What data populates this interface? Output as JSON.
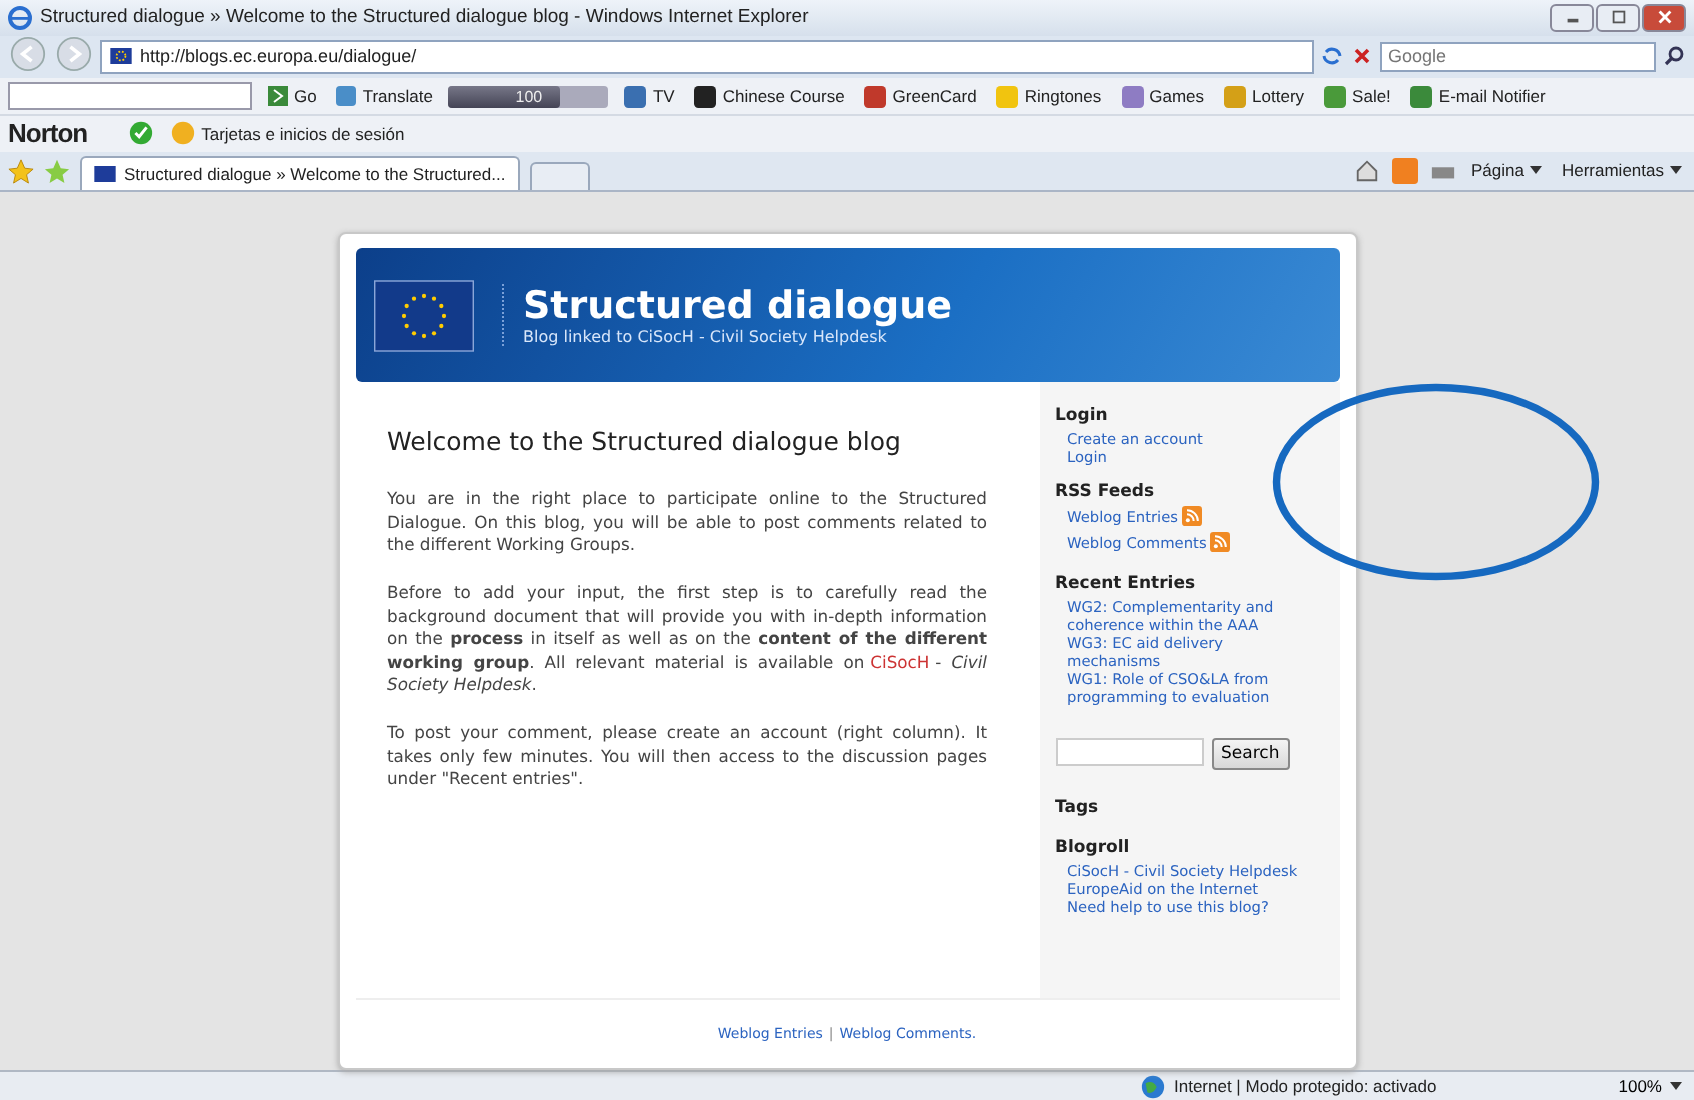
{
  "window": {
    "title": "Structured dialogue » Welcome to the Structured dialogue blog - Windows Internet Explorer"
  },
  "address_bar": {
    "url": "http://blogs.ec.europa.eu/dialogue/"
  },
  "search_box": {
    "placeholder": "Google"
  },
  "toolbar": {
    "go": "Go",
    "translate": "Translate",
    "volume": {
      "reading": "100",
      "level": 0.7
    },
    "items": [
      "TV",
      "Chinese Course",
      "GreenCard",
      "Ringtones",
      "Games",
      "Lottery",
      "Sale!",
      "E-mail Notifier"
    ]
  },
  "norton_bar": {
    "brand": "Norton",
    "cards": "Tarjetas e inicios de sesión"
  },
  "tabs": [
    {
      "label": "Structured dialogue » Welcome to the Structured...",
      "selected": true
    }
  ],
  "command_bar": [
    "Página",
    "Herramientas"
  ],
  "page": {
    "title": "Structured dialogue",
    "subtitle": "Blog linked to CiSocH - Civil Society Helpdesk",
    "heading": "Welcome to the Structured dialogue blog",
    "paragraphs": [
      {
        "before": "You are in the right place to participate online to the Structured Dialogue. On this blog, you will be able to post comments related to the different Working Groups."
      },
      {
        "before": "Before to add your input, the first step is to carefully read the background document that will provide you with in-depth information on the **process** in itself as well as on the **content of the different working group**. All relevant material is available on",
        "link": "CiSocH",
        "after": "- *Civil Society Helpdesk*."
      },
      {
        "before": "To post your comment, please create an account (right column). It takes only few minutes. You will then access to the discussion pages under \"Recent entries\"."
      }
    ],
    "sidebar": [
      {
        "kind": "heading",
        "text": "Login"
      },
      {
        "kind": "link",
        "text": "Create an account"
      },
      {
        "kind": "link",
        "text": "Login"
      },
      {
        "kind": "heading",
        "text": "RSS Feeds"
      },
      {
        "kind": "feed",
        "text": "Weblog Entries"
      },
      {
        "kind": "feed",
        "text": "Weblog Comments"
      },
      {
        "kind": "heading",
        "text": "Recent Entries"
      },
      {
        "kind": "link",
        "text": "WG2: Complementarity and coherence within the AAA"
      },
      {
        "kind": "link",
        "text": "WG3: EC aid delivery mechanisms"
      },
      {
        "kind": "link",
        "text": "WG1: Role of CSO&LA from programming to evaluation"
      },
      {
        "kind": "search",
        "text": "Search"
      },
      {
        "kind": "heading",
        "text": "Tags"
      },
      {
        "kind": "heading",
        "text": "Blogroll"
      },
      {
        "kind": "link",
        "text": "CiSocH - Civil Society Helpdesk"
      },
      {
        "kind": "link",
        "text": "EuropeAid on the Internet"
      },
      {
        "kind": "link",
        "text": "Need help to use this blog?"
      }
    ],
    "footer": [
      {
        "text": "Weblog Entries"
      },
      {
        "text": "Weblog Comments."
      }
    ],
    "footer_separator": "|"
  },
  "status_bar": {
    "zone": "Internet | Modo protegido: activado",
    "zoom": "100%"
  }
}
